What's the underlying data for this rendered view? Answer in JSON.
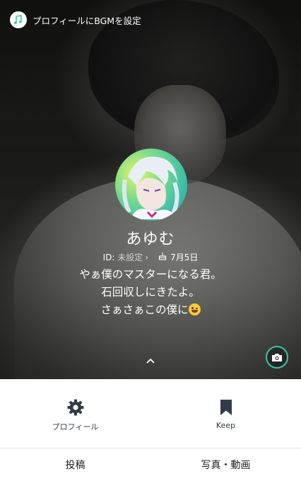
{
  "bgm": {
    "label": "プロフィールにBGMを設定",
    "icon": "music-note-icon"
  },
  "profile": {
    "name": "あゆむ",
    "id_label": "ID:",
    "id_value": "未設定",
    "birthday": "7月5日",
    "bio_lines": [
      "やぁ僕のマスターになる君。",
      "石回収しにきたよ。",
      "さぁさぁこの僕に"
    ],
    "bio_emoji": "winking-face-emoji"
  },
  "actions": [
    {
      "label": "プロフィール",
      "icon": "gear-icon"
    },
    {
      "label": "Keep",
      "icon": "bookmark-icon"
    }
  ],
  "tabs": [
    {
      "label": "投稿"
    },
    {
      "label": "写真・動画"
    }
  ],
  "colors": {
    "accent": "#3cc6a6",
    "action_icon": "#333b4a"
  }
}
